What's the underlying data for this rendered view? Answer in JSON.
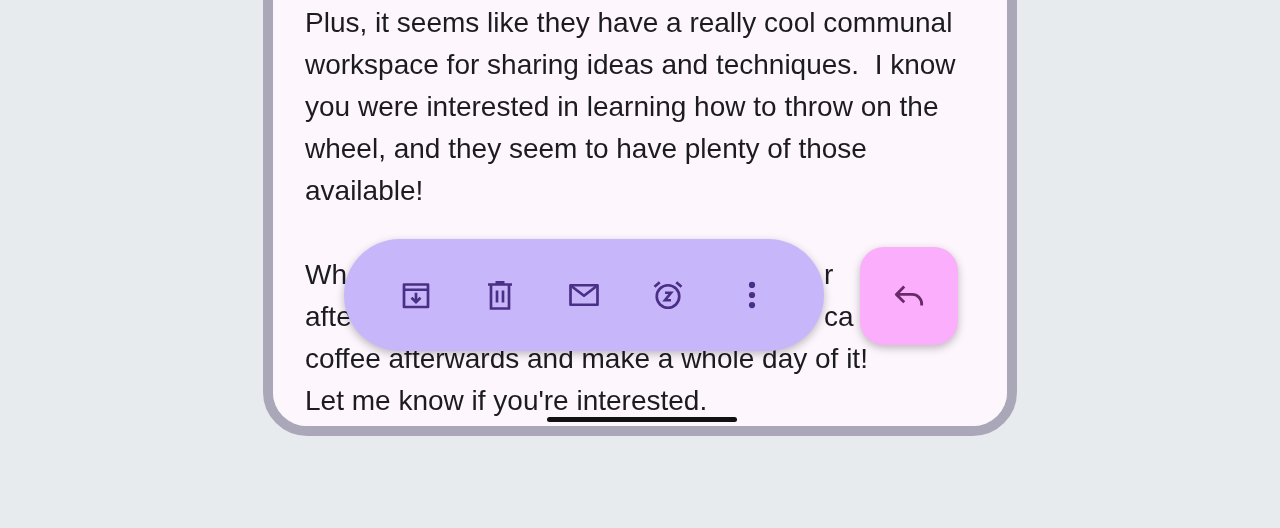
{
  "message": {
    "paragraph": "Plus, it seems like they have a really cool communal\nworkspace for sharing ideas and techniques.  I know\nyou were interested in learning how to throw on the\nwheel, and they seem to have plenty of those\navailable!",
    "covered_lines": [
      {
        "start": "Wh",
        "end": "r"
      },
      {
        "start": "afte",
        "end": "ca"
      }
    ],
    "lines": [
      "coffee afterwards and make a whole day of it!",
      "Let me know if you're interested."
    ]
  },
  "toolbar": {
    "actions": [
      {
        "kind": "archive"
      },
      {
        "kind": "delete"
      },
      {
        "kind": "mail"
      },
      {
        "kind": "snooze"
      },
      {
        "kind": "more"
      }
    ]
  },
  "fab": {
    "kind": "reply"
  }
}
